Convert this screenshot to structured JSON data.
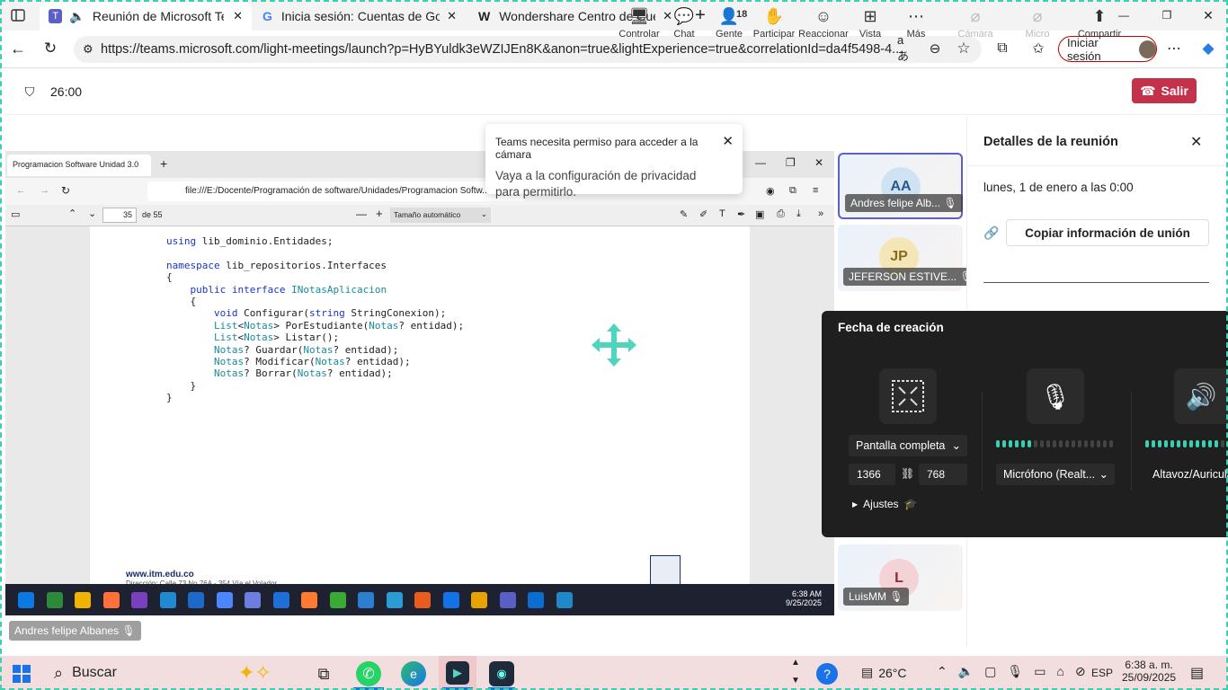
{
  "browser": {
    "tabs": [
      {
        "title": "Reunión de Microsoft Teams",
        "icon": "teams-icon"
      },
      {
        "title": "Inicia sesión: Cuentas de Google",
        "icon": "google-icon"
      },
      {
        "title": "Wondershare Centro de Cuenta",
        "icon": "wondershare-icon"
      }
    ],
    "url": "https://teams.microsoft.com/light-meetings/launch?p=HyBYuldk3eWZIJEn8K&anon=true&lightExperience=true&correlationId=da4f5498-4...",
    "signin_label": "Iniciar sesión"
  },
  "teams": {
    "timer": "26:00",
    "toolbar": [
      {
        "label": "Controlar",
        "icon": "control-icon"
      },
      {
        "label": "Chat",
        "icon": "chat-icon"
      },
      {
        "label": "Gente",
        "icon": "people-icon",
        "badge": "18"
      },
      {
        "label": "Participar",
        "icon": "raise-hand-icon"
      },
      {
        "label": "Reaccionar",
        "icon": "react-icon"
      },
      {
        "label": "Vista",
        "icon": "view-icon"
      },
      {
        "label": "Más",
        "icon": "more-icon"
      },
      {
        "label": "Cámara",
        "icon": "camera-off-icon"
      },
      {
        "label": "Micro",
        "icon": "mic-off-icon"
      },
      {
        "label": "Compartir",
        "icon": "share-icon"
      }
    ],
    "leave_label": "Salir",
    "permission_toast": {
      "title": "Teams necesita permiso para acceder a la cámara",
      "body": "Vaya a la configuración de privacidad para permitirlo."
    }
  },
  "shared": {
    "tab_title": "Programacion Software Unidad 3.0",
    "pdf_url": "file:///E:/Docente/Programación de software/Unidades/Programacion Softw...",
    "page_number": "35",
    "page_total": "de 55",
    "zoom": "Tamaño automático",
    "code_lines": [
      "using lib_dominio.Entidades;",
      "",
      "namespace lib_repositorios.Interfaces",
      "{",
      "    public interface INotasAplicacion",
      "    {",
      "        void Configurar(string StringConexion);",
      "        List<Notas> PorEstudiante(Notas? entidad);",
      "        List<Notas> Listar();",
      "        Notas? Guardar(Notas? entidad);",
      "        Notas? Modificar(Notas? entidad);",
      "        Notas? Borrar(Notas? entidad);",
      "    }",
      "}"
    ],
    "footer_url": "www.itm.edu.co",
    "footer_addr": "Dirección: Calle 73 No 76A - 354 Vía el Volador",
    "inner_time": "6:38 AM",
    "inner_date": "9/25/2025",
    "presenter_name": "Andres felipe Albanes"
  },
  "participants": [
    {
      "initials": "AA",
      "name": "Andres felipe Alb...",
      "color": "#cfe3f3"
    },
    {
      "initials": "JP",
      "name": "JEFERSON ESTIVE...",
      "color": "#f5e6b8"
    },
    {
      "initials": "L",
      "name": "LuisMM",
      "color": "#f3d3d6"
    }
  ],
  "details": {
    "title": "Detalles de la reunión",
    "date": "lunes, 1 de enero a las 0:00",
    "copy_label": "Copiar información de unión"
  },
  "device_panel": {
    "title": "Fecha de creación",
    "fullscreen_label": "Pantalla completa",
    "width": "1366",
    "height": "768",
    "mic_label": "Micrófono (Realt...",
    "speaker_label": "Altavoz/Auricula",
    "settings_label": "Ajustes"
  },
  "taskbar": {
    "search_label": "Buscar",
    "temperature": "26°C",
    "lang": "ESP",
    "time": "6:38 a. m.",
    "date": "25/09/2025"
  }
}
